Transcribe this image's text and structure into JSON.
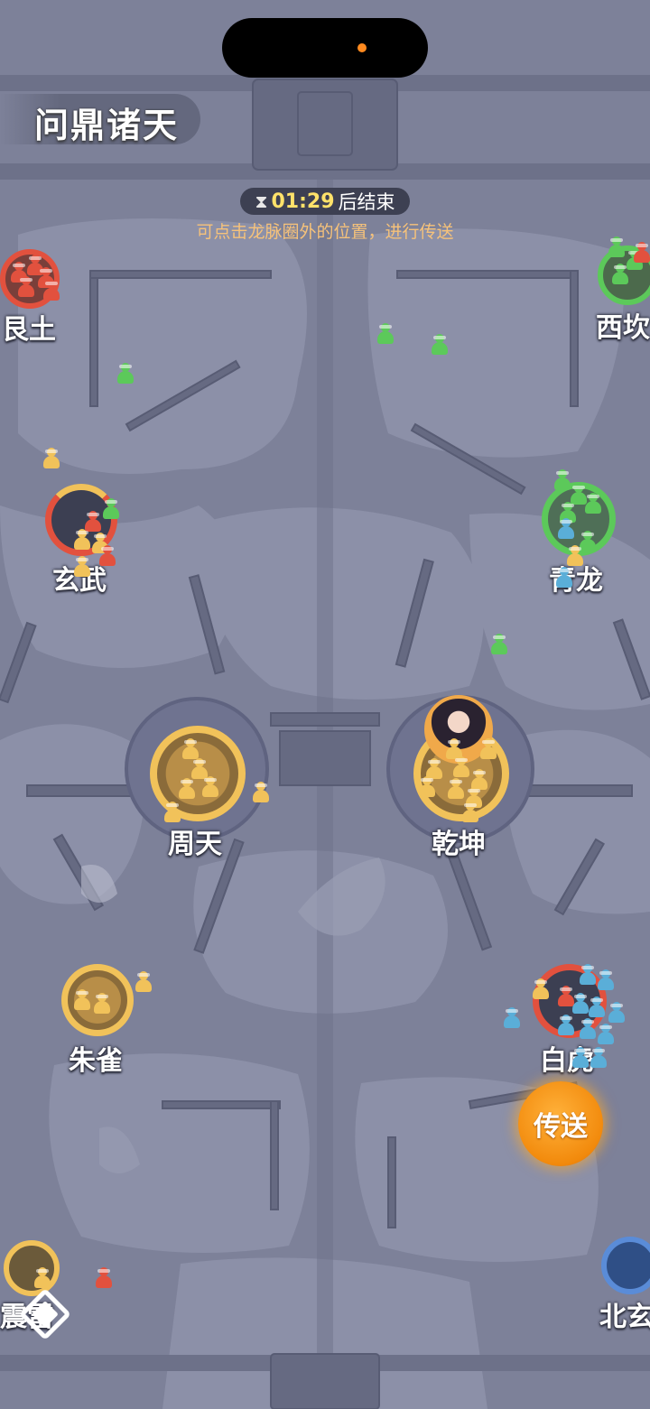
{
  "app": {
    "title": "问鼎诸天"
  },
  "timer": {
    "time": "01:29",
    "suffix": "后结束",
    "icon": "hourglass-icon"
  },
  "hint": "可点击龙脉圈外的位置，进行传送",
  "teleport_button": {
    "label": "传送"
  },
  "nodes": {
    "gen_tu": "艮土",
    "xi_kan": "西坎",
    "xuan_wu": "玄武",
    "qing_long": "青龙",
    "zhou_tian": "周天",
    "qian_kun": "乾坤",
    "zhu_que": "朱雀",
    "bai_hu": "白虎",
    "zhen_lei": "震雷",
    "bei_xuan": "北玄"
  },
  "faction_colors": {
    "yellow": "#f1c25a",
    "green": "#5cc95a",
    "red": "#e2513e",
    "blue": "#5aaed8"
  }
}
